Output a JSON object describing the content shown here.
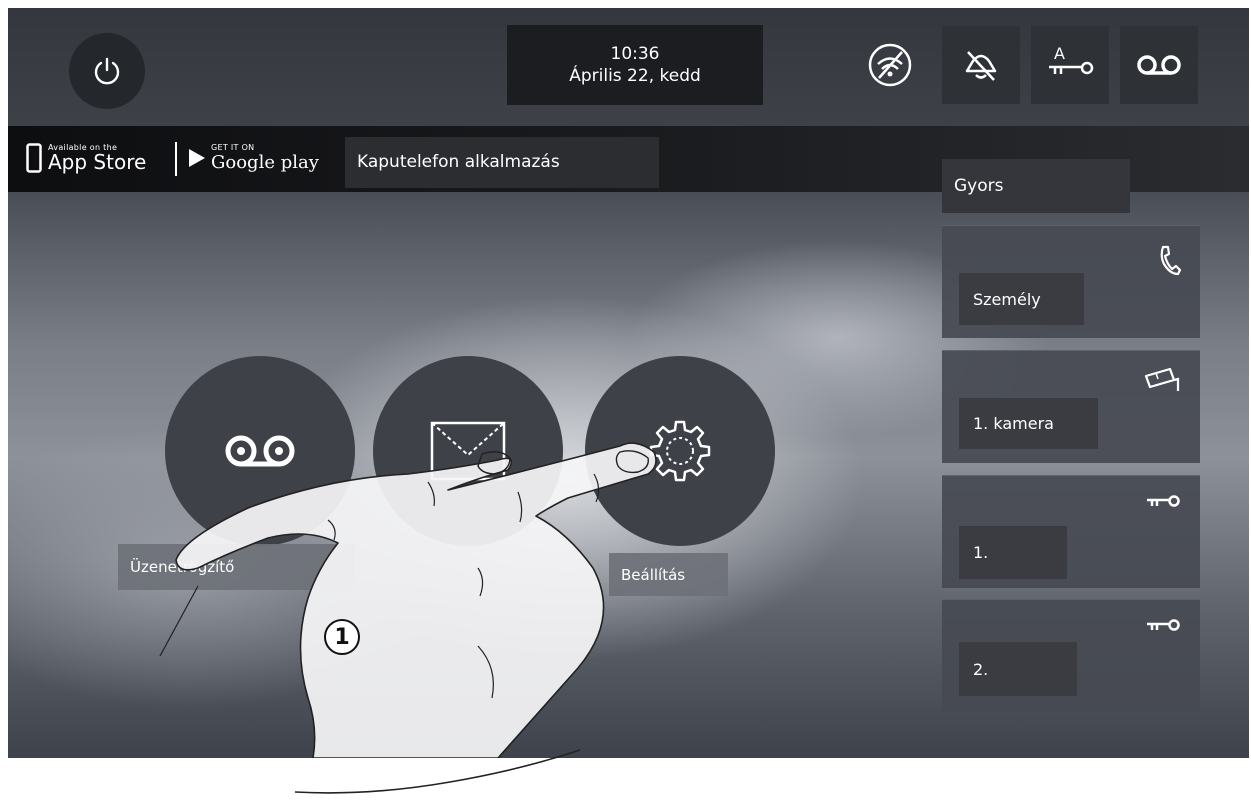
{
  "header": {
    "time": "10:36",
    "date": "Április 22, kedd",
    "status_icons": [
      "wifi-off-icon",
      "alarm-off-icon",
      "door-key-icon",
      "voicemail-icon"
    ]
  },
  "app_bar": {
    "appstore_small": "Available on the",
    "appstore_big": "App Store",
    "googleplay_small": "GET IT ON",
    "googleplay_big": "Google play",
    "app_label": "Kaputelefon alkalmazás"
  },
  "quick": {
    "title": "Gyors",
    "items": [
      {
        "label": "Személy",
        "icon": "phone-icon"
      },
      {
        "label": "1. kamera",
        "icon": "camera-icon"
      },
      {
        "label": "1.",
        "icon": "key-icon"
      },
      {
        "label": "2.",
        "icon": "key-icon"
      }
    ]
  },
  "main": {
    "answering_machine_label": "Üzenetrögzítő",
    "settings_label": "Beállítás",
    "step_marker": "1"
  },
  "colors": {
    "tile": "#464a52",
    "label_bg": "#3a3c42",
    "dark": "#1c1d21"
  }
}
